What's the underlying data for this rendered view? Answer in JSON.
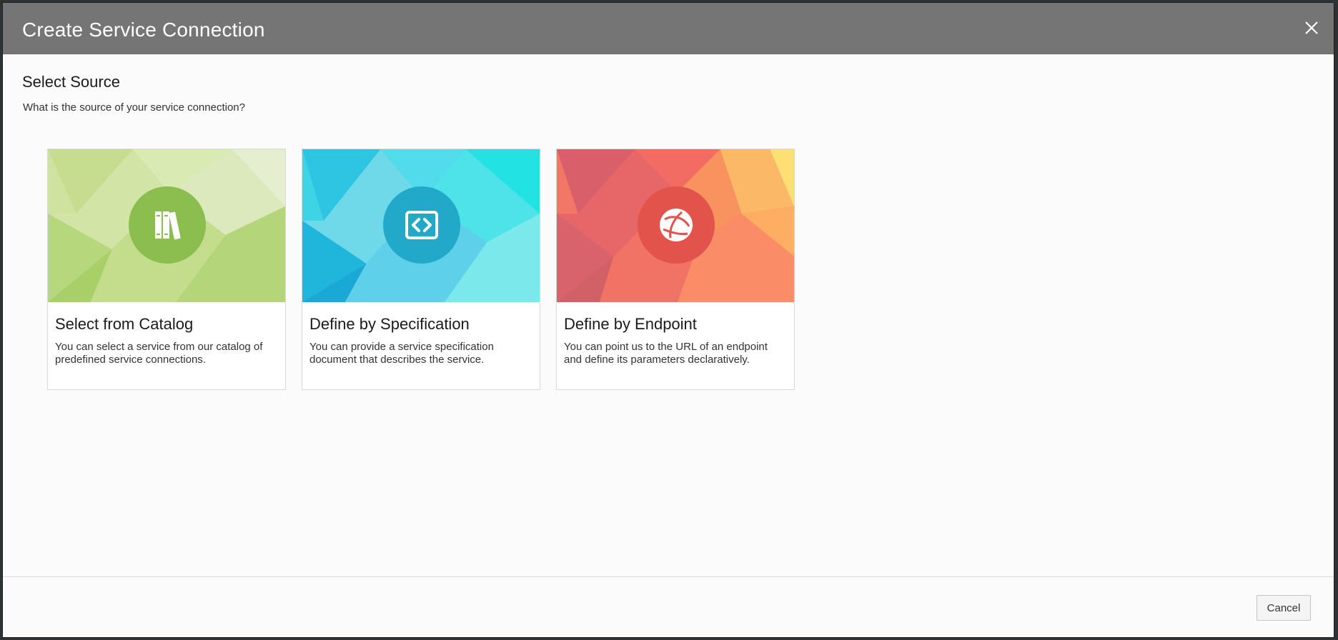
{
  "dialog": {
    "title": "Create Service Connection",
    "close_icon": "close-icon"
  },
  "section": {
    "title": "Select Source",
    "subtitle": "What is the source of your service connection?"
  },
  "cards": [
    {
      "title": "Select from Catalog",
      "description": "You can select a service from our catalog of predefined service connections.",
      "icon": "books-icon",
      "accent": "#8bbd4f"
    },
    {
      "title": "Define by Specification",
      "description": "You can provide a service specification document that describes the service.",
      "icon": "code-icon",
      "accent": "#22a9c9"
    },
    {
      "title": "Define by Endpoint",
      "description": "You can point us to the URL of an endpoint and define its parameters declaratively.",
      "icon": "globe-icon",
      "accent": "#e2534b"
    }
  ],
  "footer": {
    "cancel_label": "Cancel"
  }
}
